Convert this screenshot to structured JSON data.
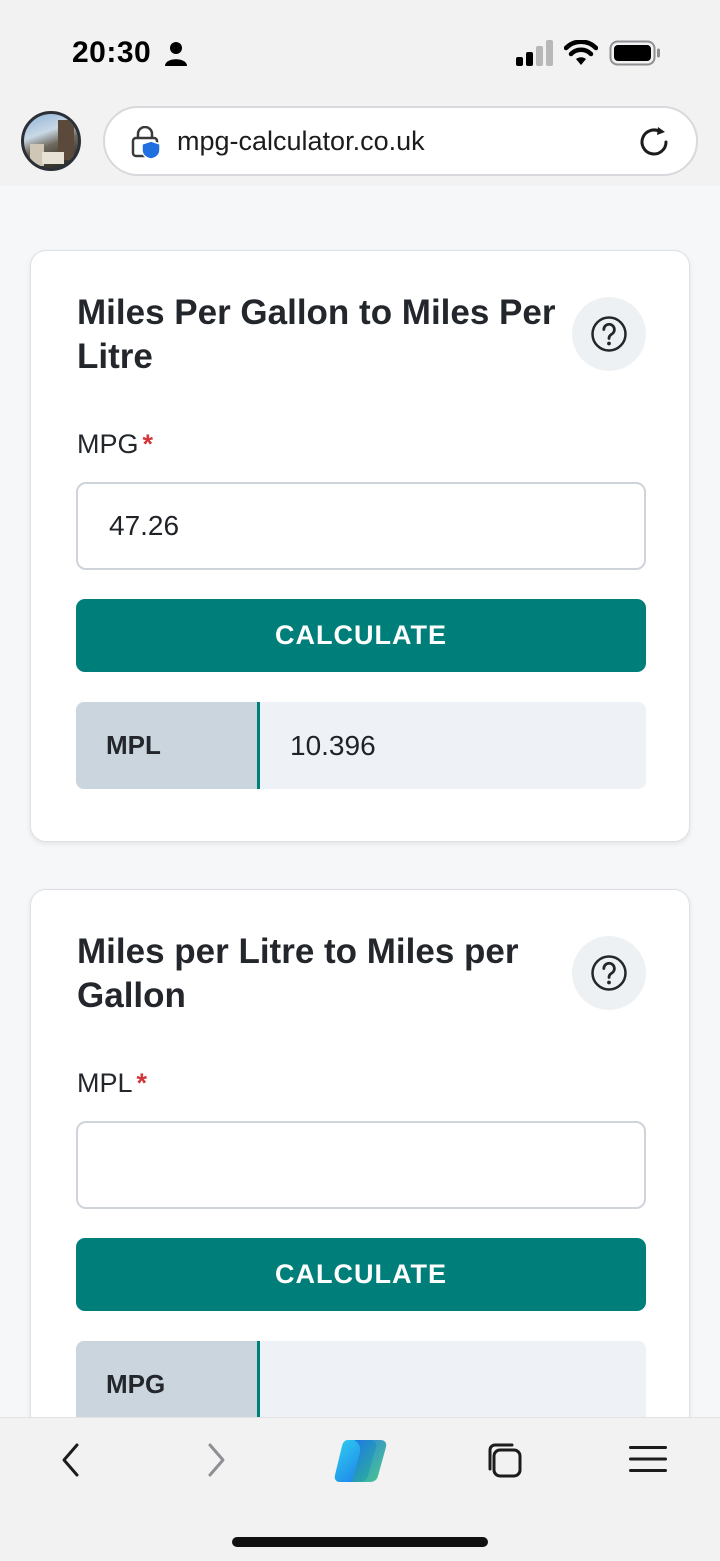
{
  "status_bar": {
    "time": "20:30"
  },
  "browser": {
    "url": "mpg-calculator.co.uk"
  },
  "calculators": [
    {
      "title": "Miles Per Gallon to Miles Per Litre",
      "input_label": "MPG",
      "required_mark": "*",
      "input_value": "47.26",
      "button_label": "CALCULATE",
      "result_label": "MPL",
      "result_value": "10.396"
    },
    {
      "title": "Miles per Litre to Miles per Gallon",
      "input_label": "MPL",
      "required_mark": "*",
      "input_value": "",
      "button_label": "CALCULATE",
      "result_label": "MPG",
      "result_value": ""
    }
  ],
  "colors": {
    "accent": "#007f7a",
    "required": "#d1363b",
    "result_label_bg": "#cbd5de",
    "result_value_bg": "#eef1f5"
  },
  "icons": {
    "status": [
      "person-icon",
      "signal-icon",
      "wifi-icon",
      "battery-icon"
    ],
    "browser": [
      "profile-avatar",
      "lock-shield-icon",
      "reload-icon"
    ],
    "card": [
      "help-icon"
    ],
    "toolbar": [
      "back-icon",
      "forward-icon",
      "copilot-icon",
      "tabs-icon",
      "menu-icon"
    ]
  }
}
